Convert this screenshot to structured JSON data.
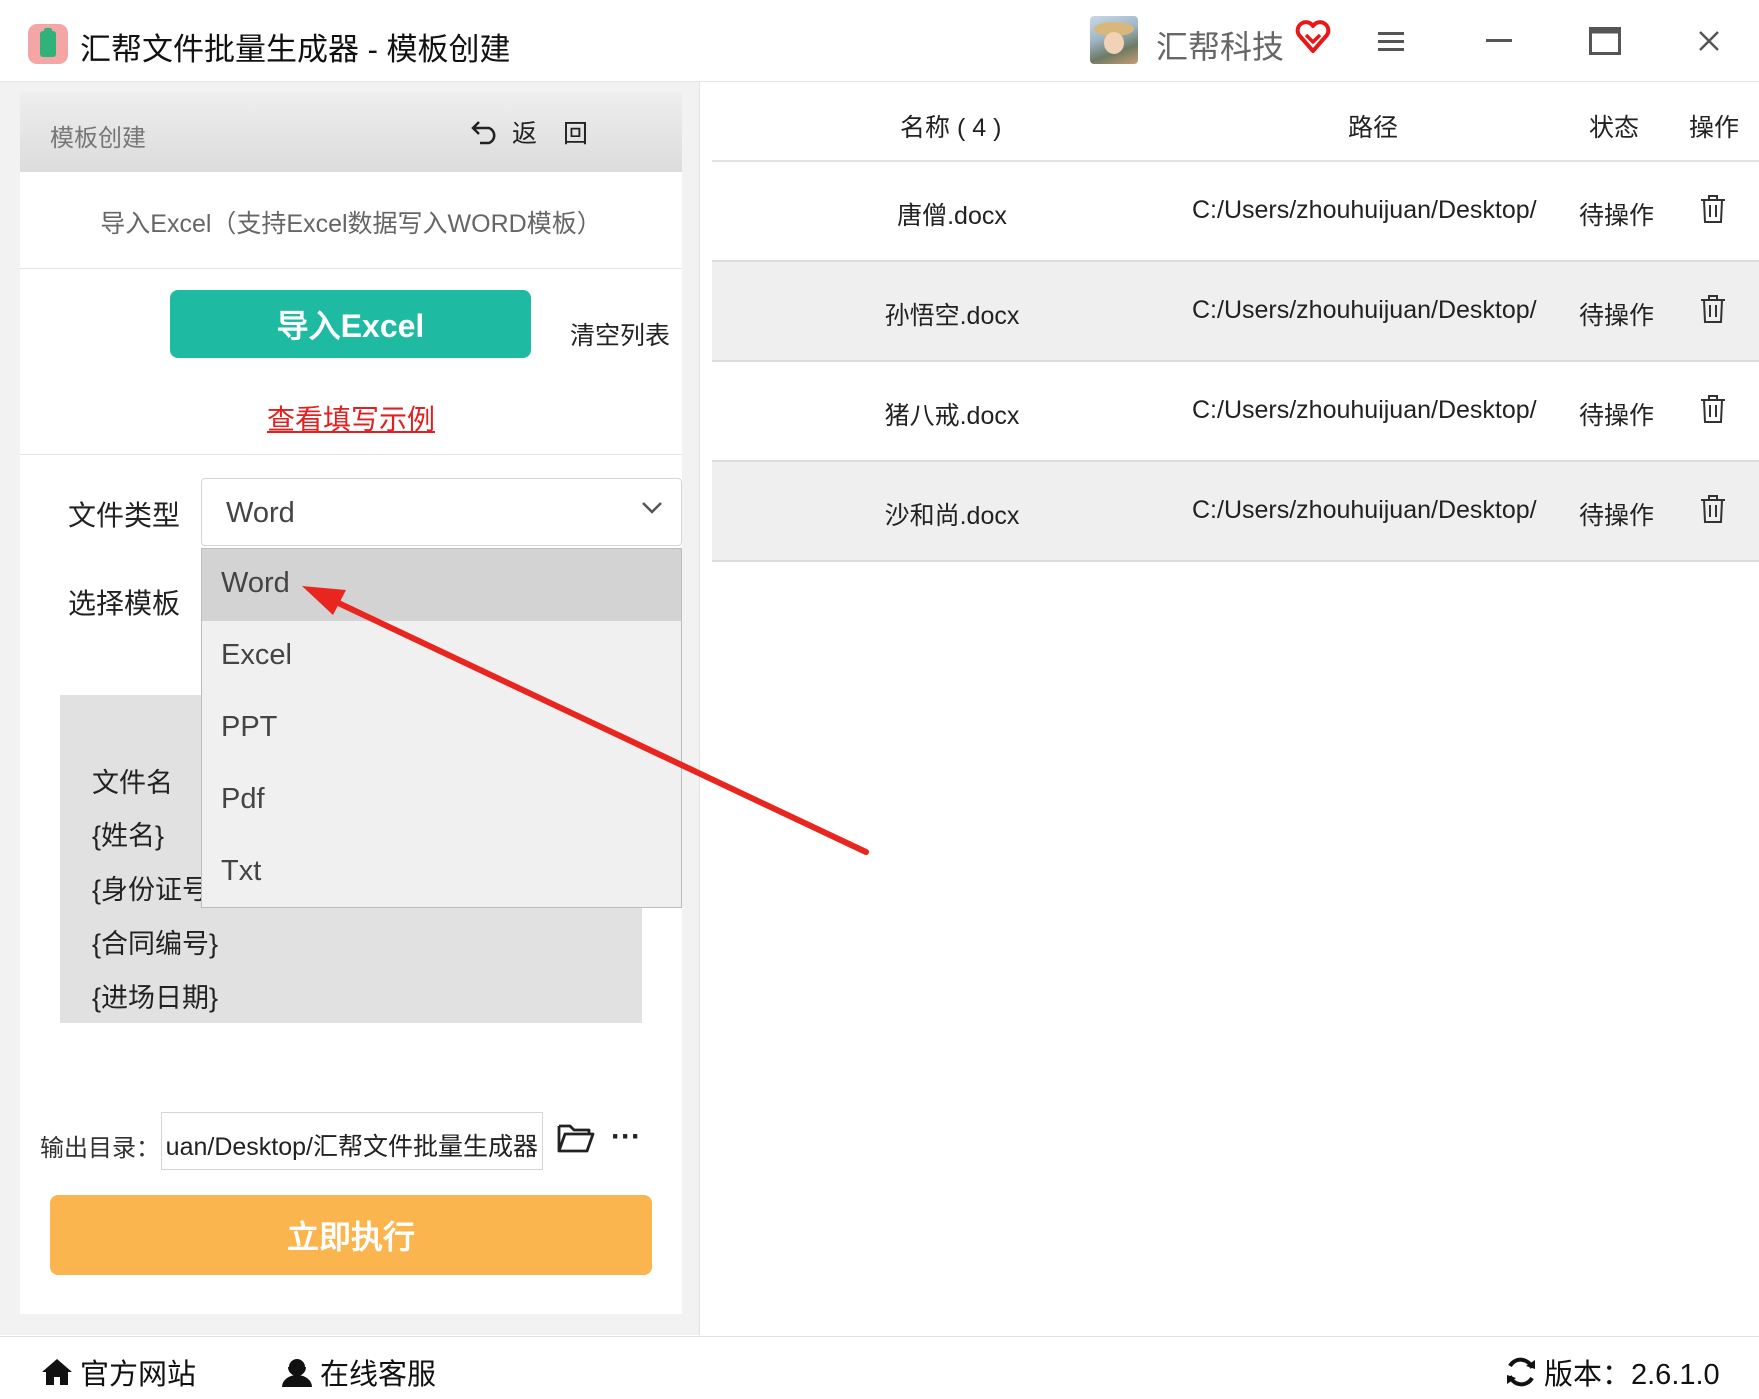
{
  "window": {
    "title": "汇帮文件批量生成器 - 模板创建",
    "brand": "汇帮科技"
  },
  "left": {
    "header_title": "模板创建",
    "back_label": "返回",
    "import_hint": "导入Excel（支持Excel数据写入WORD模板）",
    "import_button": "导入Excel",
    "clear_list": "清空列表",
    "example_link": "查看填写示例",
    "file_type_label": "文件类型",
    "file_type_value": "Word",
    "file_type_options": [
      "Word",
      "Excel",
      "PPT",
      "Pdf",
      "Txt"
    ],
    "template_label": "选择模板",
    "template_lines": [
      "文件名",
      "{姓名}",
      "{身份证号}",
      "{合同编号}",
      "{进场日期}"
    ],
    "output_label": "输出目录：",
    "output_value": "uan/Desktop/汇帮文件批量生成器",
    "run_button": "立即执行"
  },
  "table": {
    "headers": {
      "name": "名称 ( 4 )",
      "path": "路径",
      "status": "状态",
      "action": "操作"
    },
    "rows": [
      {
        "name": "唐僧.docx",
        "path": "C:/Users/zhouhuijuan/Desktop/",
        "status": "待操作"
      },
      {
        "name": "孙悟空.docx",
        "path": "C:/Users/zhouhuijuan/Desktop/",
        "status": "待操作"
      },
      {
        "name": "猪八戒.docx",
        "path": "C:/Users/zhouhuijuan/Desktop/",
        "status": "待操作"
      },
      {
        "name": "沙和尚.docx",
        "path": "C:/Users/zhouhuijuan/Desktop/",
        "status": "待操作"
      }
    ]
  },
  "footer": {
    "website": "官方网站",
    "support": "在线客服",
    "version": "版本：2.6.1.0"
  },
  "colors": {
    "import_button": "#1fbaa2",
    "run_button": "#fbb54e",
    "example_link": "#e22020",
    "arrow": "#e8261f"
  },
  "icons": [
    "app-icon",
    "avatar",
    "heart-icon",
    "menu-icon",
    "minimize-icon",
    "maximize-icon",
    "close-icon",
    "back-icon",
    "chevron-down-icon",
    "folder-icon",
    "more-icon",
    "trash-icon",
    "home-icon",
    "user-icon",
    "refresh-icon"
  ]
}
